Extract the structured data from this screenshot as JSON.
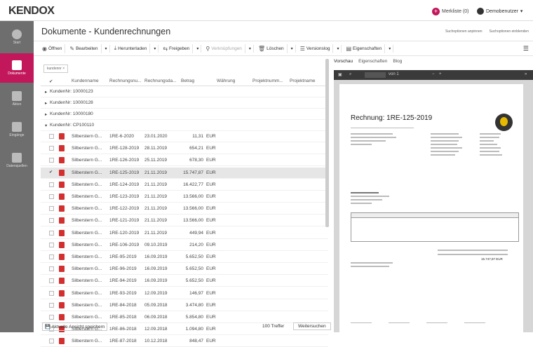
{
  "app": {
    "logo": "KENDOX",
    "merkliste": "Merkliste (0)",
    "user": "Demobenutzer"
  },
  "sidebar": [
    {
      "label": "Start"
    },
    {
      "label": "Dokumente"
    },
    {
      "label": "Akten"
    },
    {
      "label": "Eingänge"
    },
    {
      "label": "Datenquellen"
    }
  ],
  "page_title": "Dokumente - Kundenrechnungen",
  "top_links": [
    "Suchoptionen anpinnen",
    "Suchoptionen einblenden"
  ],
  "toolbar": [
    "Öffnen",
    "Bearbeiten",
    "Herunterladen",
    "Freigeben",
    "Verknüpfungen",
    "Löschen",
    "Versionslog",
    "Eigenschaften"
  ],
  "filter_chip": "kundennr ×",
  "columns": [
    "Kundenname",
    "Rechnungsnu...",
    "Rechnungsda...",
    "Betrag",
    "Währung",
    "Projektnumm...",
    "Projektname"
  ],
  "groups": [
    "KundenNr: 10000123",
    "KundenNr: 10000128",
    "KundenNr: 10000180",
    "KundenNr: CP100110"
  ],
  "rows": [
    {
      "name": "Silberstern G...",
      "nr": "1RE-6-2020",
      "date": "23.01.2020",
      "amount": "11,31",
      "cur": "EUR"
    },
    {
      "name": "Silberstern G...",
      "nr": "1RE-128-2019",
      "date": "28.11.2019",
      "amount": "654,21",
      "cur": "EUR"
    },
    {
      "name": "Silberstern G...",
      "nr": "1RE-126-2019",
      "date": "25.11.2019",
      "amount": "678,30",
      "cur": "EUR"
    },
    {
      "name": "Silberstern G...",
      "nr": "1RE-125-2019",
      "date": "21.11.2019",
      "amount": "15.747,87",
      "cur": "EUR"
    },
    {
      "name": "Silberstern G...",
      "nr": "1RE-124-2019",
      "date": "21.11.2019",
      "amount": "16.422,77",
      "cur": "EUR"
    },
    {
      "name": "Silberstern G...",
      "nr": "1RE-123-2019",
      "date": "21.11.2019",
      "amount": "13.566,00",
      "cur": "EUR"
    },
    {
      "name": "Silberstern G...",
      "nr": "1RE-122-2019",
      "date": "21.11.2019",
      "amount": "13.566,00",
      "cur": "EUR"
    },
    {
      "name": "Silberstern G...",
      "nr": "1RE-121-2019",
      "date": "21.11.2019",
      "amount": "13.566,00",
      "cur": "EUR"
    },
    {
      "name": "Silberstern G...",
      "nr": "1RE-120-2019",
      "date": "21.11.2019",
      "amount": "449,94",
      "cur": "EUR"
    },
    {
      "name": "Silberstern G...",
      "nr": "1RE-106-2019",
      "date": "09.10.2019",
      "amount": "214,20",
      "cur": "EUR"
    },
    {
      "name": "Silberstern G...",
      "nr": "1RE-95-2019",
      "date": "16.09.2019",
      "amount": "5.652,50",
      "cur": "EUR"
    },
    {
      "name": "Silberstern G...",
      "nr": "1RE-96-2019",
      "date": "16.09.2019",
      "amount": "5.652,50",
      "cur": "EUR"
    },
    {
      "name": "Silberstern G...",
      "nr": "1RE-94-2019",
      "date": "16.09.2019",
      "amount": "5.652,50",
      "cur": "EUR"
    },
    {
      "name": "Silberstern G...",
      "nr": "1RE-93-2019",
      "date": "12.09.2019",
      "amount": "146,97",
      "cur": "EUR"
    },
    {
      "name": "Silberstern G...",
      "nr": "1RE-84-2018",
      "date": "05.09.2018",
      "amount": "3.474,80",
      "cur": "EUR"
    },
    {
      "name": "Silberstern G...",
      "nr": "1RE-85-2018",
      "date": "06.09.2018",
      "amount": "5.854,80",
      "cur": "EUR"
    },
    {
      "name": "Silberstern G...",
      "nr": "1RE-86-2018",
      "date": "12.09.2018",
      "amount": "1.094,80",
      "cur": "EUR"
    },
    {
      "name": "Silberstern G...",
      "nr": "1RE-87-2018",
      "date": "10.12.2018",
      "amount": "848,47",
      "cur": "EUR"
    }
  ],
  "footer": {
    "save_view": "Aktuelle Ansicht speichern",
    "hits": "100 Treffer",
    "search_more": "Weitersuchen"
  },
  "preview": {
    "tabs": [
      "Vorschau",
      "Eigenschaften",
      "Blog"
    ],
    "page_of": "von 1",
    "doc_title": "Rechnung: 1RE-125-2019",
    "total": "15.747,87 EUR"
  },
  "colors": {
    "accent": "#c2185b",
    "sidebar": "#6e6e6e"
  }
}
